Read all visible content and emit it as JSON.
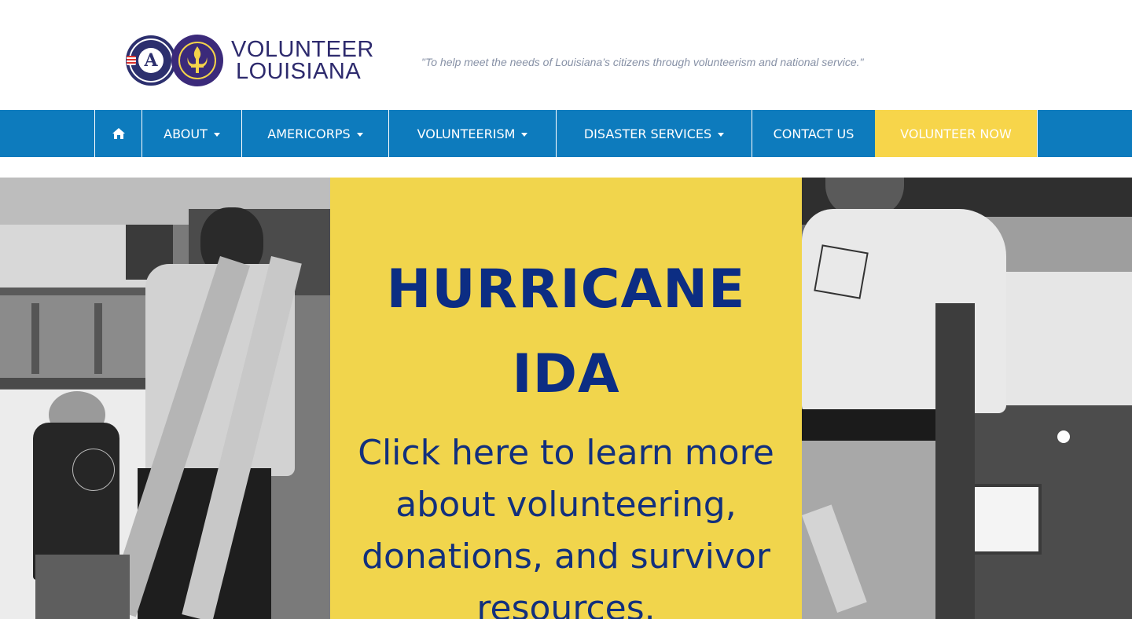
{
  "header": {
    "logo": {
      "seal_letter": "A",
      "line1": "VOLUNTEER",
      "line2": "LOUISIANA"
    },
    "tagline": "\"To help meet the needs of Louisiana’s citizens through volunteerism and national service.\""
  },
  "nav": {
    "home_icon": "home-icon",
    "items": [
      {
        "label": "ABOUT",
        "dropdown": true
      },
      {
        "label": "AMERICORPS",
        "dropdown": true
      },
      {
        "label": "VOLUNTEERISM",
        "dropdown": true
      },
      {
        "label": "DISASTER SERVICES",
        "dropdown": true
      },
      {
        "label": "CONTACT US",
        "dropdown": false
      },
      {
        "label": "VOLUNTEER NOW",
        "dropdown": false
      }
    ]
  },
  "hero": {
    "title_line1": "HURRICANE",
    "title_line2": "IDA",
    "body_line1": "Click here to learn more",
    "body_line2": "about volunteering,",
    "body_line3": "donations, and survivor",
    "body_line4": "resources."
  },
  "colors": {
    "nav_bg": "#0d7bbd",
    "cta_bg": "#f7d54a",
    "panel_bg": "#f1d54c",
    "panel_text": "#0c2d83",
    "logo_text": "#2d2a6d",
    "tagline": "#8791a6"
  }
}
